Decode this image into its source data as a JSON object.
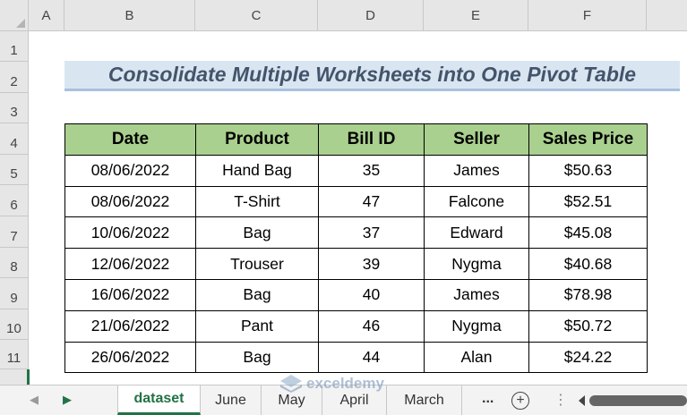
{
  "sheet": {
    "columns": [
      "A",
      "B",
      "C",
      "D",
      "E",
      "F"
    ],
    "rows": [
      "1",
      "2",
      "3",
      "4",
      "5",
      "6",
      "7",
      "8",
      "9",
      "10",
      "11"
    ]
  },
  "title": "Consolidate Multiple Worksheets into One Pivot Table",
  "table": {
    "headers": [
      "Date",
      "Product",
      "Bill ID",
      "Seller",
      "Sales Price"
    ],
    "rows": [
      [
        "08/06/2022",
        "Hand Bag",
        "35",
        "James",
        "$50.63"
      ],
      [
        "08/06/2022",
        "T-Shirt",
        "47",
        "Falcone",
        "$52.51"
      ],
      [
        "10/06/2022",
        "Bag",
        "37",
        "Edward",
        "$45.08"
      ],
      [
        "12/06/2022",
        "Trouser",
        "39",
        "Nygma",
        "$40.68"
      ],
      [
        "16/06/2022",
        "Bag",
        "40",
        "James",
        "$78.98"
      ],
      [
        "21/06/2022",
        "Pant",
        "46",
        "Nygma",
        "$50.72"
      ],
      [
        "26/06/2022",
        "Bag",
        "44",
        "Alan",
        "$24.22"
      ]
    ]
  },
  "tabs": {
    "items": [
      "dataset",
      "June",
      "May",
      "April",
      "March"
    ],
    "active": "dataset",
    "more": "...",
    "add": "+"
  },
  "watermark": "exceldemy",
  "colors": {
    "header_fill": "#a9d08e",
    "title_fill": "#d9e6f2",
    "title_text": "#44546a",
    "excel_green": "#217346"
  }
}
